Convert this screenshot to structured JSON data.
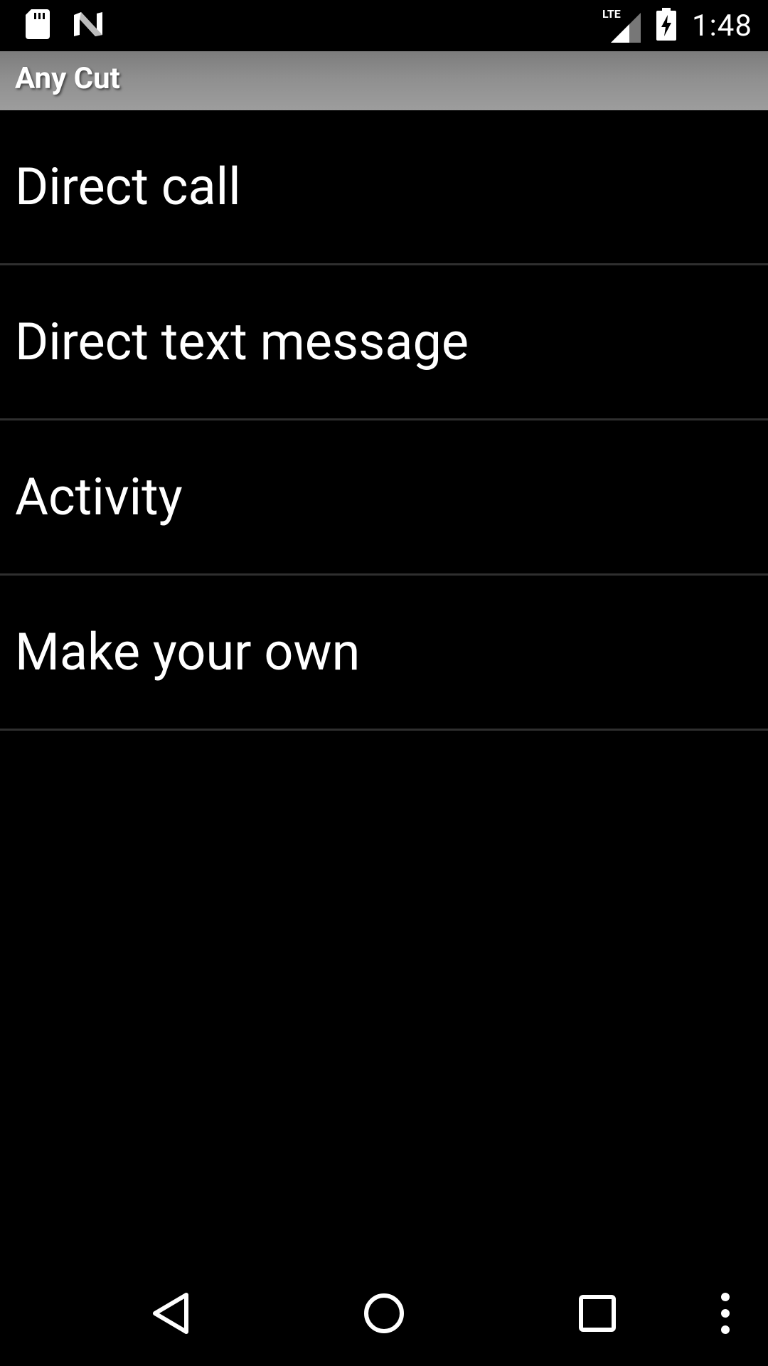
{
  "status_bar": {
    "time": "1:48",
    "network_label": "LTE",
    "icons": [
      "sd-card-icon",
      "n-logo-icon",
      "lte-signal-icon",
      "battery-charging-icon"
    ]
  },
  "app_bar": {
    "title": "Any Cut"
  },
  "list": {
    "items": [
      {
        "label": "Direct call"
      },
      {
        "label": "Direct text message"
      },
      {
        "label": "Activity"
      },
      {
        "label": "Make your own"
      }
    ]
  },
  "nav_bar": {
    "buttons": [
      "back-icon",
      "home-icon",
      "recents-icon",
      "overflow-menu-icon"
    ]
  }
}
